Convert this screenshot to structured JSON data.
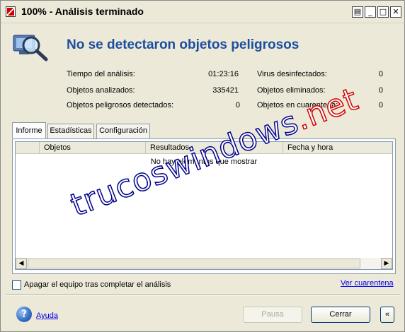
{
  "window": {
    "title": "100% - Análisis terminado"
  },
  "titlebar_buttons": [
    "restore-to-tray",
    "minimize",
    "maximize",
    "close"
  ],
  "header": {
    "headline": "No se detectaron objetos peligrosos",
    "icon": "magnifier-computer-icon"
  },
  "stats_left": [
    {
      "label": "Tiempo del análisis:",
      "value": "01:23:16"
    },
    {
      "label": "Objetos analizados:",
      "value": "335421"
    },
    {
      "label": "Objetos peligrosos detectados:",
      "value": "0"
    }
  ],
  "stats_right": [
    {
      "label": "Virus desinfectados:",
      "value": "0"
    },
    {
      "label": "Objetos eliminados:",
      "value": "0"
    },
    {
      "label": "Objetos en cuarentena:",
      "value": "0"
    }
  ],
  "tabs": [
    {
      "label": "Informe",
      "active": true
    },
    {
      "label": "Estadísticas",
      "active": false
    },
    {
      "label": "Configuración",
      "active": false
    }
  ],
  "table": {
    "columns": [
      "",
      "Objetos",
      "Resultados",
      "Fecha y hora"
    ],
    "empty_message": "No hay elementos que mostrar"
  },
  "options": {
    "shutdown_label": "Apagar el equipo tras completar el análisis",
    "shutdown_checked": false
  },
  "links": {
    "quarantine": "Ver cuarentena",
    "help": "Ayuda"
  },
  "buttons": {
    "pause": "Pausa",
    "close": "Cerrar",
    "expand": "«"
  },
  "watermark": {
    "main": "trucoswindows",
    "suffix": ".net"
  }
}
